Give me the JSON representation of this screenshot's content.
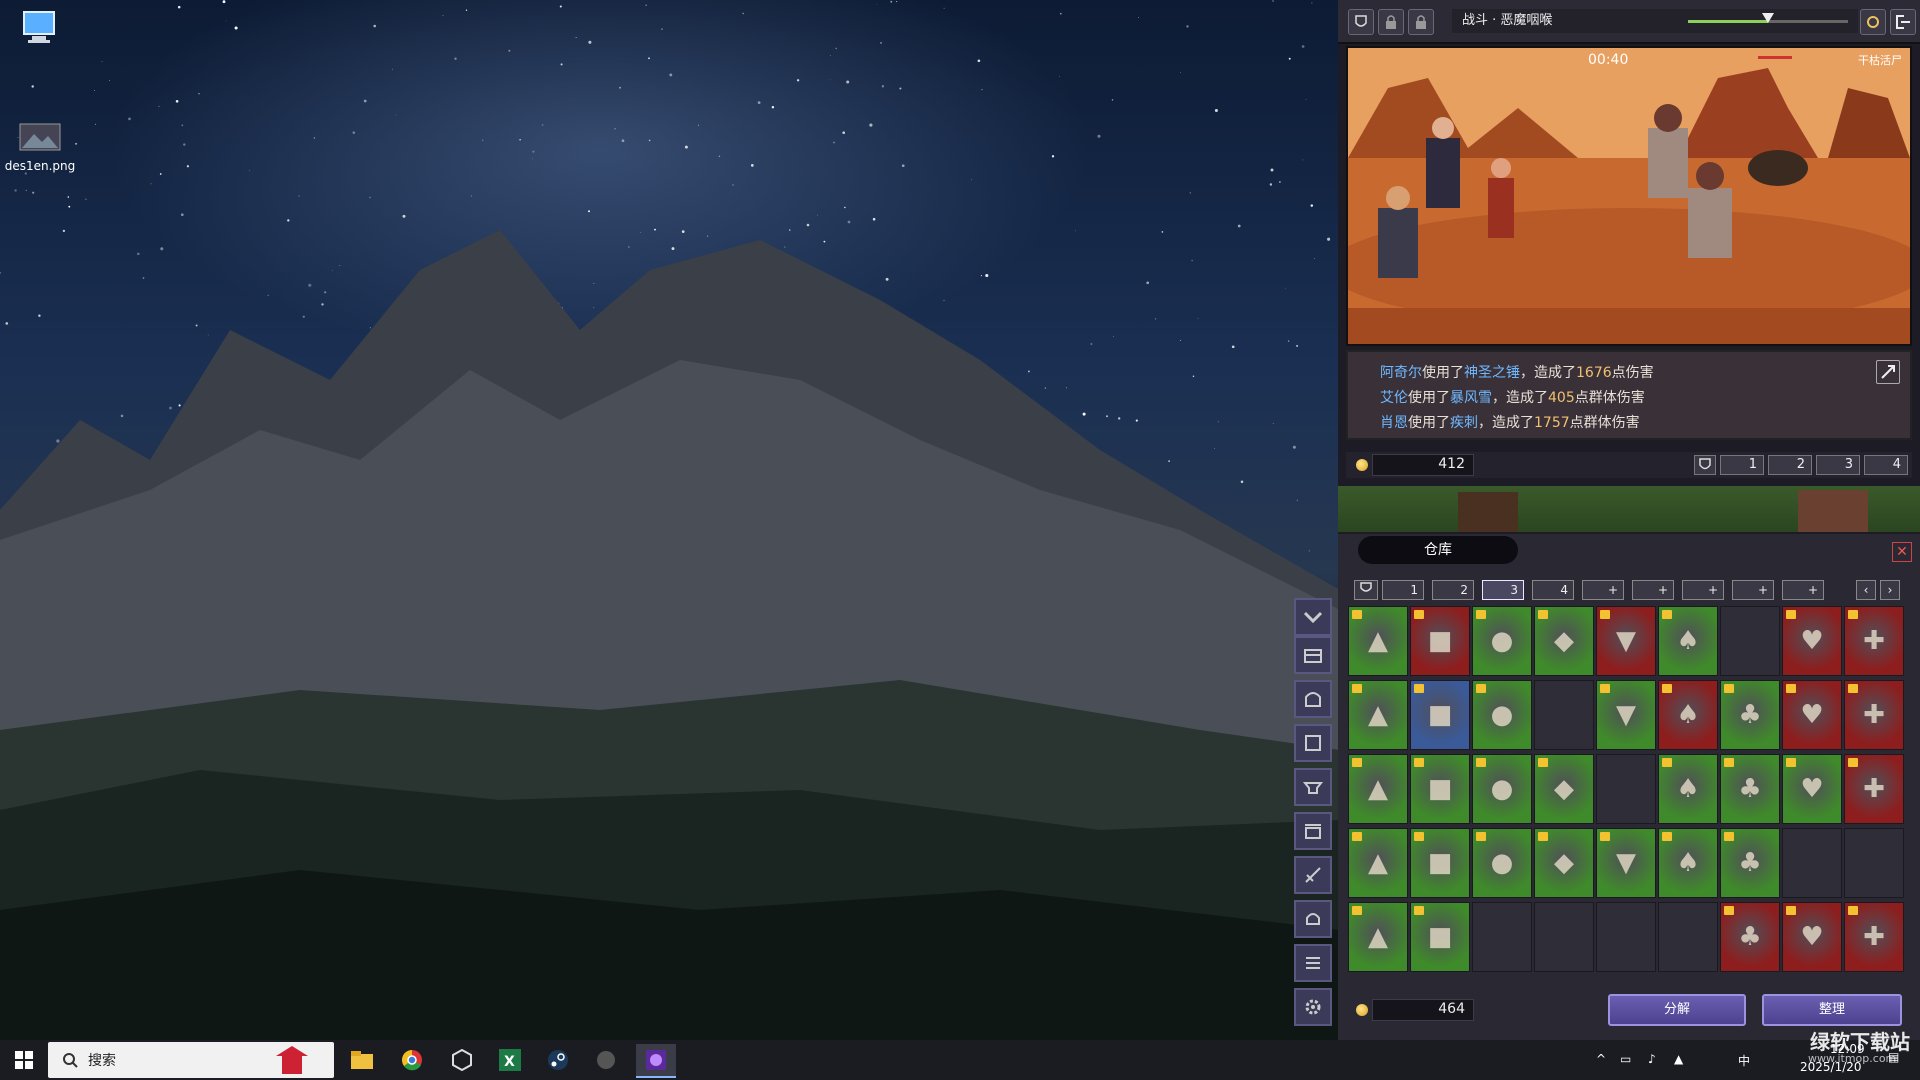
{
  "desktop": {
    "icons": [
      {
        "name": "this-pc",
        "label": ""
      },
      {
        "name": "image-file",
        "label": "des1en.png"
      }
    ]
  },
  "game": {
    "battle_title": "战斗 · 恶魔咽喉",
    "timer": "00:40",
    "enemy_label": "干枯活尸",
    "log": [
      {
        "actor": "阿奇尔",
        "t1": "使用了",
        "skill": "神圣之锤",
        "t2": "，造成了",
        "num": "1676",
        "t3": "点伤害"
      },
      {
        "actor": "艾伦",
        "t1": "使用了",
        "skill": "暴风雪",
        "t2": "，造成了",
        "num": "405",
        "t3": "点群体伤害"
      },
      {
        "actor": "肖恩",
        "t1": "使用了",
        "skill": "疾刺",
        "t2": "，造成了",
        "num": "1757",
        "t3": "点群体伤害"
      }
    ],
    "gold_top": "412",
    "team_buttons": [
      "1",
      "2",
      "3",
      "4"
    ],
    "warehouse": {
      "title": "仓库",
      "close": "✕",
      "page_tabs": [
        "1",
        "2",
        "3",
        "4",
        "+",
        "+",
        "+",
        "+",
        "+"
      ],
      "active_tab": 2,
      "nav_prev": "‹",
      "nav_next": "›",
      "gold": "464",
      "btn_decompose": "分解",
      "btn_sort": "整理"
    }
  },
  "inventory_rows": [
    [
      "g",
      "r",
      "g",
      "g",
      "r",
      "g",
      "e",
      "r",
      "r"
    ],
    [
      "g",
      "b",
      "g",
      "e",
      "g",
      "r",
      "g",
      "r",
      "r"
    ],
    [
      "g",
      "g",
      "g",
      "g",
      "e",
      "g",
      "g",
      "g",
      "r"
    ],
    [
      "g",
      "g",
      "g",
      "g",
      "g",
      "g",
      "g",
      "e",
      "e"
    ],
    [
      "g",
      "g",
      "e",
      "e",
      "e",
      "e",
      "r",
      "r",
      "r"
    ]
  ],
  "taskbar": {
    "search_placeholder": "搜索",
    "time": "12:09",
    "date": "2025/1/20",
    "ime": "中"
  },
  "watermark": {
    "line1": "绿软下载站",
    "line2": "www.itmop.com"
  },
  "colors": {
    "green": "#3f8a2a",
    "red": "#8e1d1d",
    "blue": "#3a5a9a",
    "empty": "#2f2d38"
  }
}
